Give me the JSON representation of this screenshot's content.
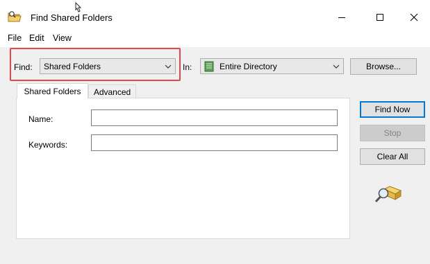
{
  "window": {
    "title": "Find Shared Folders",
    "cursor_glyph": "⛶"
  },
  "title_buttons": {
    "minimize_icon": "minimize-icon",
    "maximize_icon": "maximize-icon",
    "close_icon": "close-icon"
  },
  "menu": {
    "items": [
      {
        "label": "File"
      },
      {
        "label": "Edit"
      },
      {
        "label": "View"
      }
    ]
  },
  "search": {
    "find_label": "Find:",
    "find_value": "Shared Folders",
    "in_label": "In:",
    "in_value": "Entire Directory",
    "browse_label": "Browse..."
  },
  "tabs": [
    {
      "label": "Shared Folders",
      "active": true
    },
    {
      "label": "Advanced",
      "active": false
    }
  ],
  "form": {
    "name_label": "Name:",
    "name_value": "",
    "keywords_label": "Keywords:",
    "keywords_value": ""
  },
  "actions": {
    "find_now_label": "Find Now",
    "stop_label": "Stop",
    "clear_all_label": "Clear All"
  },
  "colors": {
    "highlight": "#e0484d",
    "accent": "#0078d7"
  }
}
